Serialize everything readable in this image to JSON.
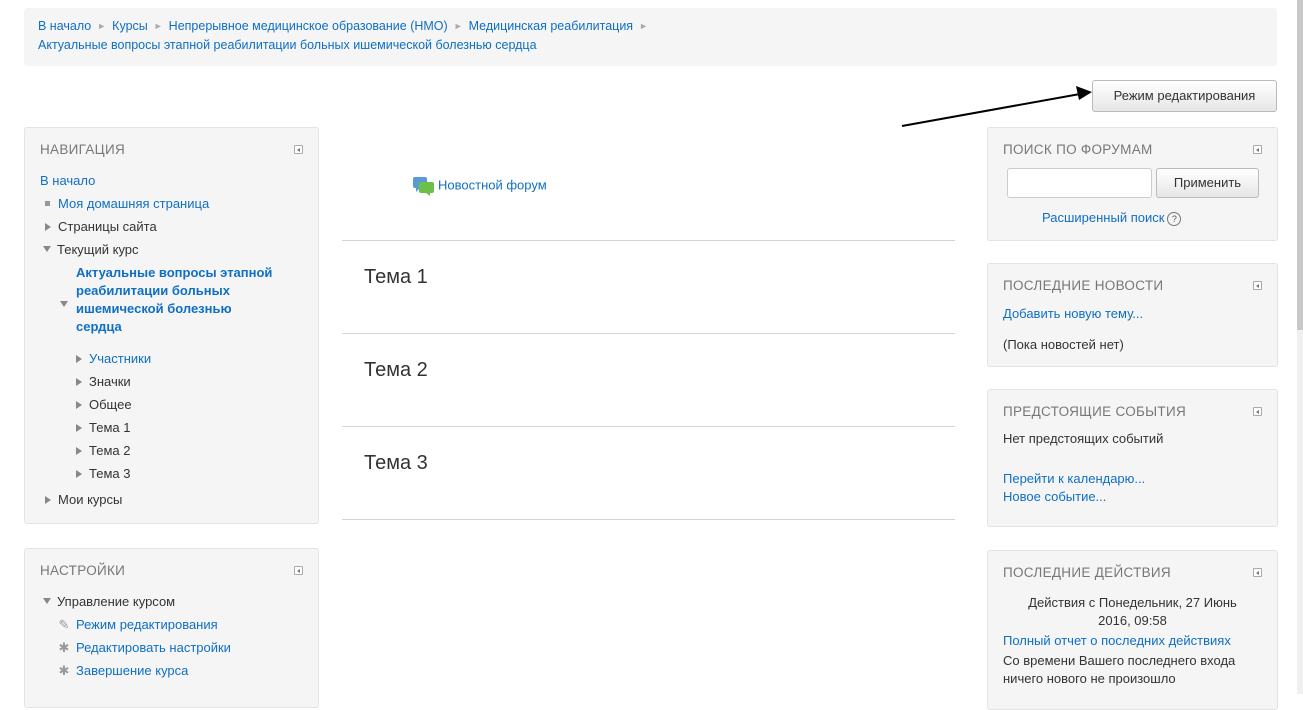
{
  "breadcrumb": {
    "items": [
      "В начало",
      "Курсы",
      "Непрерывное медицинское образование (НМО)",
      "Медицинская реабилитация"
    ],
    "current": "Актуальные вопросы этапной реабилитации больных ишемической болезнью сердца"
  },
  "edit_mode_button": "Режим редактирования",
  "navigation": {
    "title": "НАВИГАЦИЯ",
    "home": "В начало",
    "my_home": "Моя домашняя страница",
    "site_pages": "Страницы сайта",
    "current_course": "Текущий курс",
    "course_name_lines": [
      "Актуальные вопросы этапной",
      "реабилитации больных",
      "ишемической болезнью",
      "сердца"
    ],
    "course_items": [
      "Участники",
      "Значки",
      "Общее",
      "Тема 1",
      "Тема 2",
      "Тема 3"
    ],
    "my_courses": "Мои курсы"
  },
  "settings": {
    "title": "НАСТРОЙКИ",
    "course_admin": "Управление курсом",
    "items": [
      "Режим редактирования",
      "Редактировать настройки",
      "Завершение курса"
    ]
  },
  "main": {
    "news_forum": "Новостной форум",
    "sections": [
      "Тема 1",
      "Тема 2",
      "Тема 3"
    ]
  },
  "forum_search": {
    "title": "ПОИСК ПО ФОРУМАМ",
    "input_value": "",
    "submit": "Применить",
    "advanced": "Расширенный поиск",
    "help": "?"
  },
  "latest_news": {
    "title": "ПОСЛЕДНИЕ НОВОСТИ",
    "add_topic": "Добавить новую тему...",
    "empty": "(Пока новостей нет)"
  },
  "upcoming_events": {
    "title": "ПРЕДСТОЯЩИЕ СОБЫТИЯ",
    "empty": "Нет предстоящих событий",
    "calendar_link": "Перейти к календарю...",
    "new_event": "Новое событие..."
  },
  "recent_activity": {
    "title": "ПОСЛЕДНИЕ ДЕЙСТВИЯ",
    "since_line1": "Действия с Понедельник, 27 Июнь",
    "since_line2": "2016, 09:58",
    "full_report": "Полный отчет о последних действиях",
    "since_login_line1": "Со времени Вашего последнего входа",
    "since_login_line2": "ничего нового не произошло"
  }
}
